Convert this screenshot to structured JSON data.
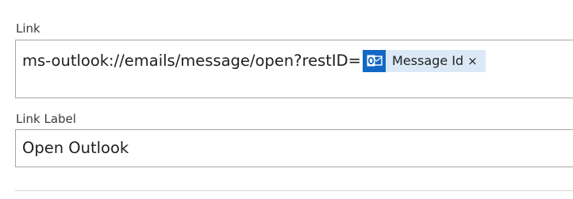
{
  "link_field": {
    "label": "Link",
    "url_text": "ms-outlook://emails/message/open?restID=",
    "token": {
      "icon": "outlook-icon",
      "label": "Message Id",
      "remove_glyph": "×"
    }
  },
  "link_label_field": {
    "label": "Link Label",
    "value": "Open Outlook"
  },
  "colors": {
    "token_background": "#dbe9f7",
    "outlook_icon_background": "#1268c4",
    "field_border": "#a6a6a6"
  }
}
